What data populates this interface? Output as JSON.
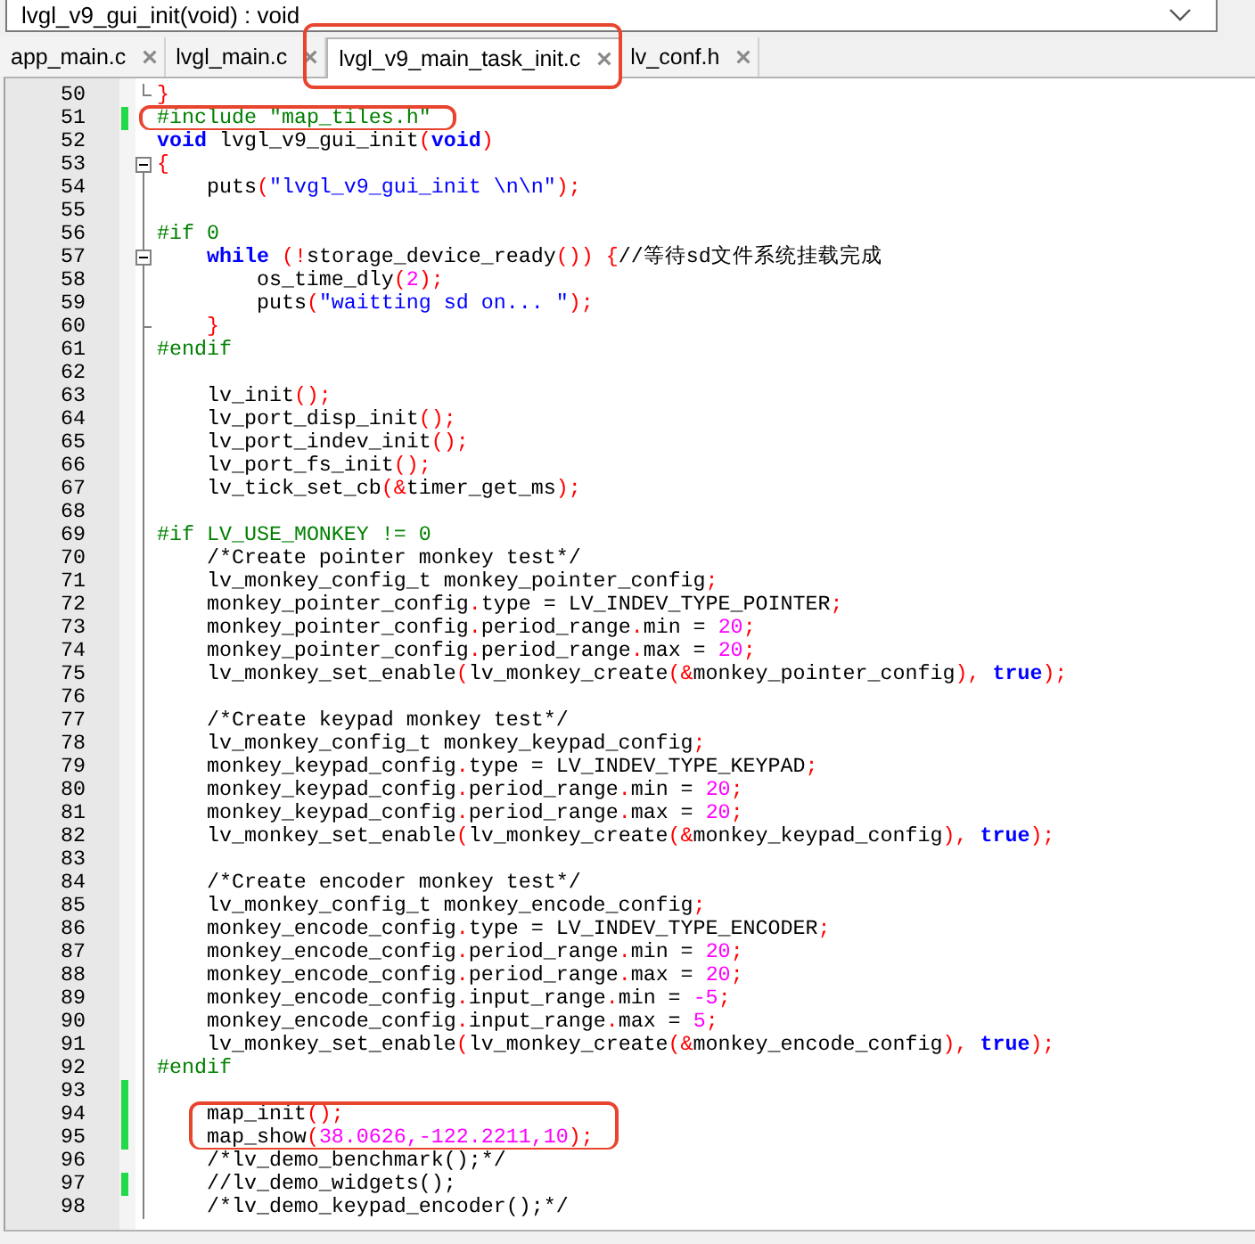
{
  "function_selector": {
    "value": "lvgl_v9_gui_init(void) : void"
  },
  "tabs": [
    {
      "label": "app_main.c",
      "selected": false,
      "circled": false
    },
    {
      "label": "lvgl_main.c",
      "selected": false,
      "circled": false
    },
    {
      "label": "lvgl_v9_main_task_init.c",
      "selected": true,
      "circled": true
    },
    {
      "label": "lv_conf.h",
      "selected": false,
      "circled": false
    }
  ],
  "editor": {
    "lines": [
      {
        "number": "50",
        "kind": "closing",
        "changed": false,
        "circled": false,
        "tokens": [
          {
            "kind": "punct",
            "text": "}"
          }
        ]
      },
      {
        "number": "51",
        "kind": "normal",
        "changed": true,
        "circled": true,
        "tokens": [
          {
            "kind": "preproc",
            "text": "#include \"map_tiles.h\""
          }
        ]
      },
      {
        "number": "52",
        "kind": "normal",
        "changed": false,
        "circled": false,
        "tokens": [
          {
            "kind": "keyword",
            "text": "void"
          },
          {
            "kind": "plain",
            "text": " lvgl_v9_gui_init"
          },
          {
            "kind": "punct",
            "text": "("
          },
          {
            "kind": "keyword",
            "text": "void"
          },
          {
            "kind": "punct",
            "text": ")"
          }
        ]
      },
      {
        "number": "53",
        "kind": "opening",
        "changed": false,
        "circled": false,
        "tokens": [
          {
            "kind": "punct",
            "text": "{"
          }
        ]
      },
      {
        "number": "54",
        "kind": "normal",
        "changed": false,
        "circled": false,
        "tokens": [
          {
            "kind": "plain",
            "text": "    puts"
          },
          {
            "kind": "punct",
            "text": "("
          },
          {
            "kind": "string",
            "text": "\"lvgl_v9_gui_init \\n\\n\""
          },
          {
            "kind": "punct",
            "text": ");"
          }
        ]
      },
      {
        "number": "55",
        "kind": "normal",
        "changed": false,
        "circled": false
      },
      {
        "number": "56",
        "kind": "normal",
        "changed": false,
        "circled": false,
        "tokens": [
          {
            "kind": "preproc",
            "text": "#if 0"
          }
        ]
      },
      {
        "number": "57",
        "kind": "opening",
        "changed": false,
        "circled": false,
        "tokens": [
          {
            "kind": "keyword",
            "text": "    while"
          },
          {
            "kind": "punct",
            "text": " (!"
          },
          {
            "kind": "plain",
            "text": "storage_device_ready"
          },
          {
            "kind": "punct",
            "text": "()) {"
          },
          {
            "kind": "plain",
            "text": "//等待sd文件系统挂载完成"
          }
        ]
      },
      {
        "number": "58",
        "kind": "normal",
        "changed": false,
        "circled": false,
        "tokens": [
          {
            "kind": "plain",
            "text": "        os_time_dly"
          },
          {
            "kind": "punct",
            "text": "("
          },
          {
            "kind": "number",
            "text": "2"
          },
          {
            "kind": "punct",
            "text": ");"
          }
        ]
      },
      {
        "number": "59",
        "kind": "normal",
        "changed": false,
        "circled": false,
        "tokens": [
          {
            "kind": "plain",
            "text": "        puts"
          },
          {
            "kind": "punct",
            "text": "("
          },
          {
            "kind": "string",
            "text": "\"waitting sd on... \""
          },
          {
            "kind": "punct",
            "text": ");"
          }
        ]
      },
      {
        "number": "60",
        "kind": "closing",
        "changed": false,
        "circled": false,
        "tokens": [
          {
            "kind": "punct",
            "text": "    }"
          }
        ]
      },
      {
        "number": "61",
        "kind": "normal",
        "changed": false,
        "circled": false,
        "tokens": [
          {
            "kind": "preproc",
            "text": "#endif"
          }
        ]
      },
      {
        "number": "62",
        "kind": "normal",
        "changed": false,
        "circled": false
      },
      {
        "number": "63",
        "kind": "normal",
        "changed": false,
        "circled": false,
        "tokens": [
          {
            "kind": "plain",
            "text": "    lv_init"
          },
          {
            "kind": "punct",
            "text": "();"
          }
        ]
      },
      {
        "number": "64",
        "kind": "normal",
        "changed": false,
        "circled": false,
        "tokens": [
          {
            "kind": "plain",
            "text": "    lv_port_disp_init"
          },
          {
            "kind": "punct",
            "text": "();"
          }
        ]
      },
      {
        "number": "65",
        "kind": "normal",
        "changed": false,
        "circled": false,
        "tokens": [
          {
            "kind": "plain",
            "text": "    lv_port_indev_init"
          },
          {
            "kind": "punct",
            "text": "();"
          }
        ]
      },
      {
        "number": "66",
        "kind": "normal",
        "changed": false,
        "circled": false,
        "tokens": [
          {
            "kind": "plain",
            "text": "    lv_port_fs_init"
          },
          {
            "kind": "punct",
            "text": "();"
          }
        ]
      },
      {
        "number": "67",
        "kind": "normal",
        "changed": false,
        "circled": false,
        "tokens": [
          {
            "kind": "plain",
            "text": "    lv_tick_set_cb"
          },
          {
            "kind": "punct",
            "text": "(&"
          },
          {
            "kind": "plain",
            "text": "timer_get_ms"
          },
          {
            "kind": "punct",
            "text": ");"
          }
        ]
      },
      {
        "number": "68",
        "kind": "normal",
        "changed": false,
        "circled": false
      },
      {
        "number": "69",
        "kind": "normal",
        "changed": false,
        "circled": false,
        "tokens": [
          {
            "kind": "preproc",
            "text": "#if LV_USE_MONKEY != 0"
          }
        ]
      },
      {
        "number": "70",
        "kind": "normal",
        "changed": false,
        "circled": false,
        "tokens": [
          {
            "kind": "plain",
            "text": "    /*Create pointer monkey test*/"
          }
        ]
      },
      {
        "number": "71",
        "kind": "normal",
        "changed": false,
        "circled": false,
        "tokens": [
          {
            "kind": "plain",
            "text": "    lv_monkey_config_t monkey_pointer_config"
          },
          {
            "kind": "punct",
            "text": ";"
          }
        ]
      },
      {
        "number": "72",
        "kind": "normal",
        "changed": false,
        "circled": false,
        "tokens": [
          {
            "kind": "plain",
            "text": "    monkey_pointer_config"
          },
          {
            "kind": "punct",
            "text": "."
          },
          {
            "kind": "plain",
            "text": "type = LV_INDEV_TYPE_POINTER"
          },
          {
            "kind": "punct",
            "text": ";"
          }
        ]
      },
      {
        "number": "73",
        "kind": "normal",
        "changed": false,
        "circled": false,
        "tokens": [
          {
            "kind": "plain",
            "text": "    monkey_pointer_config"
          },
          {
            "kind": "punct",
            "text": "."
          },
          {
            "kind": "plain",
            "text": "period_range"
          },
          {
            "kind": "punct",
            "text": "."
          },
          {
            "kind": "plain",
            "text": "min = "
          },
          {
            "kind": "number",
            "text": "20"
          },
          {
            "kind": "punct",
            "text": ";"
          }
        ]
      },
      {
        "number": "74",
        "kind": "normal",
        "changed": false,
        "circled": false,
        "tokens": [
          {
            "kind": "plain",
            "text": "    monkey_pointer_config"
          },
          {
            "kind": "punct",
            "text": "."
          },
          {
            "kind": "plain",
            "text": "period_range"
          },
          {
            "kind": "punct",
            "text": "."
          },
          {
            "kind": "plain",
            "text": "max = "
          },
          {
            "kind": "number",
            "text": "20"
          },
          {
            "kind": "punct",
            "text": ";"
          }
        ]
      },
      {
        "number": "75",
        "kind": "normal",
        "changed": false,
        "circled": false,
        "tokens": [
          {
            "kind": "plain",
            "text": "    lv_monkey_set_enable"
          },
          {
            "kind": "punct",
            "text": "("
          },
          {
            "kind": "plain",
            "text": "lv_monkey_create"
          },
          {
            "kind": "punct",
            "text": "(&"
          },
          {
            "kind": "plain",
            "text": "monkey_pointer_config"
          },
          {
            "kind": "punct",
            "text": "), "
          },
          {
            "kind": "keyword",
            "text": "true"
          },
          {
            "kind": "punct",
            "text": ");"
          }
        ]
      },
      {
        "number": "76",
        "kind": "normal",
        "changed": false,
        "circled": false
      },
      {
        "number": "77",
        "kind": "normal",
        "changed": false,
        "circled": false,
        "tokens": [
          {
            "kind": "plain",
            "text": "    /*Create keypad monkey test*/"
          }
        ]
      },
      {
        "number": "78",
        "kind": "normal",
        "changed": false,
        "circled": false,
        "tokens": [
          {
            "kind": "plain",
            "text": "    lv_monkey_config_t monkey_keypad_config"
          },
          {
            "kind": "punct",
            "text": ";"
          }
        ]
      },
      {
        "number": "79",
        "kind": "normal",
        "changed": false,
        "circled": false,
        "tokens": [
          {
            "kind": "plain",
            "text": "    monkey_keypad_config"
          },
          {
            "kind": "punct",
            "text": "."
          },
          {
            "kind": "plain",
            "text": "type = LV_INDEV_TYPE_KEYPAD"
          },
          {
            "kind": "punct",
            "text": ";"
          }
        ]
      },
      {
        "number": "80",
        "kind": "normal",
        "changed": false,
        "circled": false,
        "tokens": [
          {
            "kind": "plain",
            "text": "    monkey_keypad_config"
          },
          {
            "kind": "punct",
            "text": "."
          },
          {
            "kind": "plain",
            "text": "period_range"
          },
          {
            "kind": "punct",
            "text": "."
          },
          {
            "kind": "plain",
            "text": "min = "
          },
          {
            "kind": "number",
            "text": "20"
          },
          {
            "kind": "punct",
            "text": ";"
          }
        ]
      },
      {
        "number": "81",
        "kind": "normal",
        "changed": false,
        "circled": false,
        "tokens": [
          {
            "kind": "plain",
            "text": "    monkey_keypad_config"
          },
          {
            "kind": "punct",
            "text": "."
          },
          {
            "kind": "plain",
            "text": "period_range"
          },
          {
            "kind": "punct",
            "text": "."
          },
          {
            "kind": "plain",
            "text": "max = "
          },
          {
            "kind": "number",
            "text": "20"
          },
          {
            "kind": "punct",
            "text": ";"
          }
        ]
      },
      {
        "number": "82",
        "kind": "normal",
        "changed": false,
        "circled": false,
        "tokens": [
          {
            "kind": "plain",
            "text": "    lv_monkey_set_enable"
          },
          {
            "kind": "punct",
            "text": "("
          },
          {
            "kind": "plain",
            "text": "lv_monkey_create"
          },
          {
            "kind": "punct",
            "text": "(&"
          },
          {
            "kind": "plain",
            "text": "monkey_keypad_config"
          },
          {
            "kind": "punct",
            "text": "), "
          },
          {
            "kind": "keyword",
            "text": "true"
          },
          {
            "kind": "punct",
            "text": ");"
          }
        ]
      },
      {
        "number": "83",
        "kind": "normal",
        "changed": false,
        "circled": false
      },
      {
        "number": "84",
        "kind": "normal",
        "changed": false,
        "circled": false,
        "tokens": [
          {
            "kind": "plain",
            "text": "    /*Create encoder monkey test*/"
          }
        ]
      },
      {
        "number": "85",
        "kind": "normal",
        "changed": false,
        "circled": false,
        "tokens": [
          {
            "kind": "plain",
            "text": "    lv_monkey_config_t monkey_encode_config"
          },
          {
            "kind": "punct",
            "text": ";"
          }
        ]
      },
      {
        "number": "86",
        "kind": "normal",
        "changed": false,
        "circled": false,
        "tokens": [
          {
            "kind": "plain",
            "text": "    monkey_encode_config"
          },
          {
            "kind": "punct",
            "text": "."
          },
          {
            "kind": "plain",
            "text": "type = LV_INDEV_TYPE_ENCODER"
          },
          {
            "kind": "punct",
            "text": ";"
          }
        ]
      },
      {
        "number": "87",
        "kind": "normal",
        "changed": false,
        "circled": false,
        "tokens": [
          {
            "kind": "plain",
            "text": "    monkey_encode_config"
          },
          {
            "kind": "punct",
            "text": "."
          },
          {
            "kind": "plain",
            "text": "period_range"
          },
          {
            "kind": "punct",
            "text": "."
          },
          {
            "kind": "plain",
            "text": "min = "
          },
          {
            "kind": "number",
            "text": "20"
          },
          {
            "kind": "punct",
            "text": ";"
          }
        ]
      },
      {
        "number": "88",
        "kind": "normal",
        "changed": false,
        "circled": false,
        "tokens": [
          {
            "kind": "plain",
            "text": "    monkey_encode_config"
          },
          {
            "kind": "punct",
            "text": "."
          },
          {
            "kind": "plain",
            "text": "period_range"
          },
          {
            "kind": "punct",
            "text": "."
          },
          {
            "kind": "plain",
            "text": "max = "
          },
          {
            "kind": "number",
            "text": "20"
          },
          {
            "kind": "punct",
            "text": ";"
          }
        ]
      },
      {
        "number": "89",
        "kind": "normal",
        "changed": false,
        "circled": false,
        "tokens": [
          {
            "kind": "plain",
            "text": "    monkey_encode_config"
          },
          {
            "kind": "punct",
            "text": "."
          },
          {
            "kind": "plain",
            "text": "input_range"
          },
          {
            "kind": "punct",
            "text": "."
          },
          {
            "kind": "plain",
            "text": "min = "
          },
          {
            "kind": "number",
            "text": "-5"
          },
          {
            "kind": "punct",
            "text": ";"
          }
        ]
      },
      {
        "number": "90",
        "kind": "normal",
        "changed": false,
        "circled": false,
        "tokens": [
          {
            "kind": "plain",
            "text": "    monkey_encode_config"
          },
          {
            "kind": "punct",
            "text": "."
          },
          {
            "kind": "plain",
            "text": "input_range"
          },
          {
            "kind": "punct",
            "text": "."
          },
          {
            "kind": "plain",
            "text": "max = "
          },
          {
            "kind": "number",
            "text": "5"
          },
          {
            "kind": "punct",
            "text": ";"
          }
        ]
      },
      {
        "number": "91",
        "kind": "normal",
        "changed": false,
        "circled": false,
        "tokens": [
          {
            "kind": "plain",
            "text": "    lv_monkey_set_enable"
          },
          {
            "kind": "punct",
            "text": "("
          },
          {
            "kind": "plain",
            "text": "lv_monkey_create"
          },
          {
            "kind": "punct",
            "text": "(&"
          },
          {
            "kind": "plain",
            "text": "monkey_encode_config"
          },
          {
            "kind": "punct",
            "text": "), "
          },
          {
            "kind": "keyword",
            "text": "true"
          },
          {
            "kind": "punct",
            "text": ");"
          }
        ]
      },
      {
        "number": "92",
        "kind": "normal",
        "changed": false,
        "circled": false,
        "tokens": [
          {
            "kind": "preproc",
            "text": "#endif"
          }
        ]
      },
      {
        "number": "93",
        "kind": "normal",
        "changed": true,
        "circled": false
      },
      {
        "number": "94",
        "kind": "normal",
        "changed": true,
        "circled": true,
        "tokens": [
          {
            "kind": "plain",
            "text": "    map_init"
          },
          {
            "kind": "punct",
            "text": "();"
          }
        ]
      },
      {
        "number": "95",
        "kind": "normal",
        "changed": true,
        "circled": true,
        "tokens": [
          {
            "kind": "plain",
            "text": "    map_show"
          },
          {
            "kind": "punct",
            "text": "("
          },
          {
            "kind": "number",
            "text": "38.0626,-122.2211,10"
          },
          {
            "kind": "punct",
            "text": ");"
          }
        ]
      },
      {
        "number": "96",
        "kind": "normal",
        "changed": false,
        "circled": false,
        "tokens": [
          {
            "kind": "plain",
            "text": "    /*lv_demo_benchmark();*/"
          }
        ]
      },
      {
        "number": "97",
        "kind": "normal",
        "changed": true,
        "circled": false,
        "tokens": [
          {
            "kind": "plain",
            "text": "    //lv_demo_widgets();"
          }
        ]
      },
      {
        "number": "98",
        "kind": "normal",
        "changed": false,
        "circled": false,
        "tokens": [
          {
            "kind": "plain",
            "text": "    /*lv_demo_keypad_encoder();*/"
          }
        ]
      }
    ]
  }
}
